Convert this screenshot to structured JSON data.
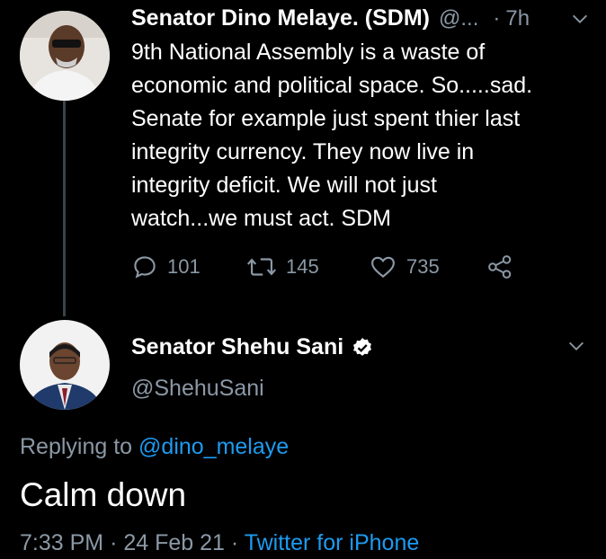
{
  "parent_tweet": {
    "author_name": "Senator Dino Melaye. (SDM)",
    "handle_truncated": "@...",
    "time_sep": "·",
    "time": "7h",
    "lines": [
      "9th National Assembly is a waste of",
      "economic and political space. So.....sad.",
      "Senate for example just spent thier last",
      "integrity currency. They now live in",
      "integrity deficit. We will not just",
      "watch...we must act. SDM"
    ],
    "replies": "101",
    "retweets": "145",
    "likes": "735",
    "icons": [
      "reply-icon",
      "retweet-icon",
      "like-icon",
      "share-icon",
      "chevron-down-icon"
    ]
  },
  "reply_tweet": {
    "author_name": "Senator Shehu Sani",
    "handle": "@ShehuSani",
    "replying_prefix": "Replying to",
    "replying_to": "@dino_melaye",
    "text": "Calm down",
    "time": "7:33 PM",
    "sep1": "·",
    "date": "24 Feb 21",
    "sep2": "·",
    "source": "Twitter for iPhone",
    "icons": [
      "verified-icon",
      "chevron-down-icon"
    ]
  },
  "colors": {
    "background": "#000000",
    "text": "#ffffff",
    "muted": "#8b98a5",
    "link": "#1d9bf0",
    "thread_line": "#38444d"
  }
}
